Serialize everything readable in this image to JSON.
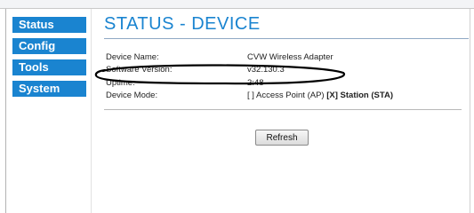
{
  "nav": {
    "items": [
      {
        "label": "Status"
      },
      {
        "label": "Config"
      },
      {
        "label": "Tools"
      },
      {
        "label": "System"
      }
    ]
  },
  "main": {
    "title": "STATUS - DEVICE",
    "rows": [
      {
        "label": "Device Name:",
        "value": "CVW Wireless Adapter"
      },
      {
        "label": "Software Version:",
        "value": "v32.130.3"
      },
      {
        "label": "Uptime:",
        "value": "2:48"
      },
      {
        "label": "Device Mode:",
        "option_ap": "[ ] Access Point (AP)",
        "option_sta": "[X] Station (STA)"
      }
    ],
    "refresh_label": "Refresh"
  },
  "colors": {
    "accent": "#1a84d0",
    "annotation_oval": "#000000"
  }
}
